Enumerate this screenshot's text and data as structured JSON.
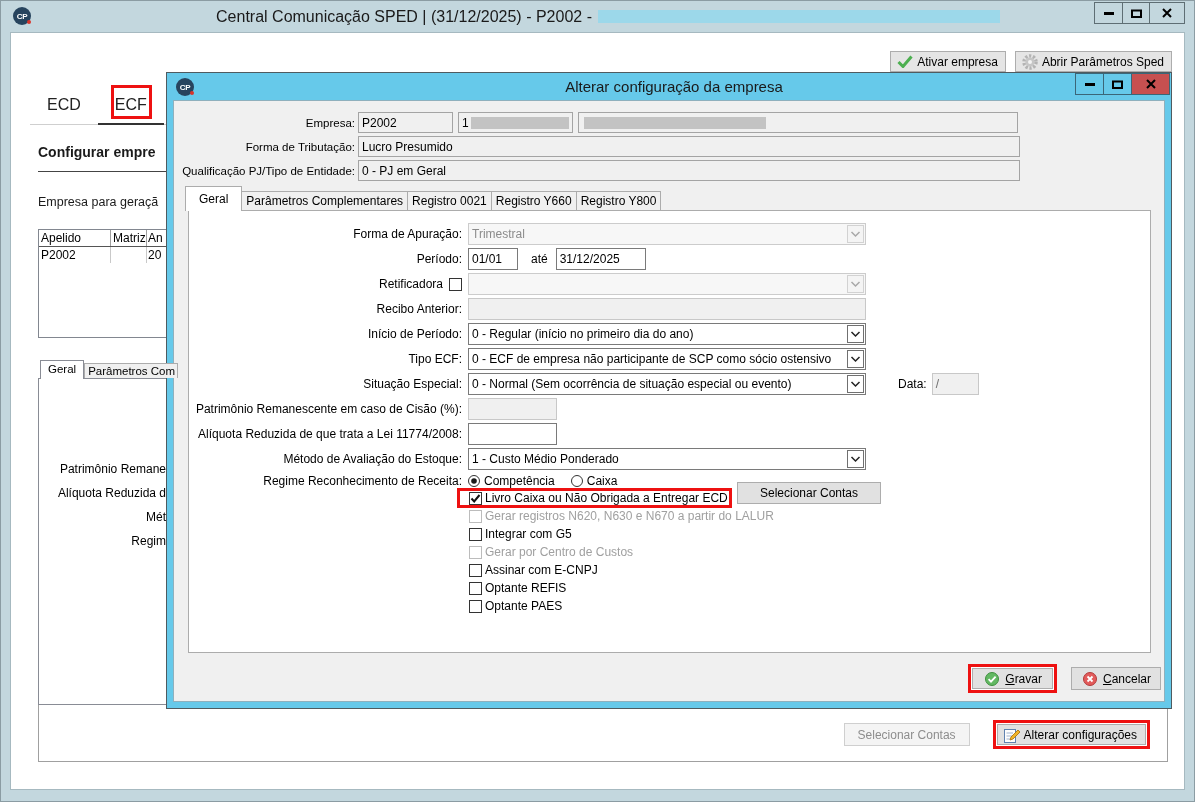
{
  "main_window": {
    "logo_text": "CP",
    "title": "Central Comunicação SPED | (31/12/2025) - P2002 -",
    "title_redacted": true,
    "toolbar_buttons": [
      {
        "label": "Ativar empresa"
      },
      {
        "label": "Abrir Parâmetros Sped"
      }
    ],
    "tabs": [
      {
        "label": "ECD",
        "selected": false,
        "highlighted": false
      },
      {
        "label": "ECF",
        "selected": true,
        "highlighted": true
      }
    ],
    "heading": "Configurar empre",
    "company_prompt": "Empresa para geraçã",
    "table": {
      "columns": [
        "Apelido",
        "Matriz",
        "An"
      ],
      "rows": [
        [
          "P2002",
          null,
          "20"
        ]
      ]
    },
    "panel_tabs": [
      {
        "label": "Geral",
        "selected": true
      },
      {
        "label": "Parâmetros Com",
        "selected": false
      }
    ],
    "panel_labels": [
      "Patrimônio Remane",
      "Alíquota Reduzida d",
      "Mét",
      "Regim"
    ],
    "footer_buttons": [
      {
        "label": "Selecionar Contas",
        "disabled": true,
        "highlighted": false
      },
      {
        "label": "Alterar configurações",
        "disabled": false,
        "highlighted": true
      }
    ]
  },
  "dialog": {
    "logo_text": "CP",
    "title": "Alterar configuração da empresa",
    "header_rows": [
      {
        "label": "Empresa:",
        "fields": [
          {
            "value": "P2002",
            "redacted": false
          },
          {
            "value": "1",
            "redacted": true
          },
          {
            "redacted": true
          }
        ]
      },
      {
        "label": "Forma de Tributação:",
        "fields": [
          {
            "value": "Lucro Presumido",
            "redacted": false
          }
        ]
      },
      {
        "label": "Qualificação PJ/Tipo de Entidade:",
        "fields": [
          {
            "value": "0 - PJ em Geral",
            "redacted": false
          }
        ]
      }
    ],
    "tabs": [
      {
        "label": "Geral",
        "selected": true
      },
      {
        "label": "Parâmetros Complementares",
        "selected": false
      },
      {
        "label": "Registro 0021",
        "selected": false
      },
      {
        "label": "Registro Y660",
        "selected": false
      },
      {
        "label": "Registro Y800",
        "selected": false
      }
    ],
    "form_rows": [
      {
        "kind": "select",
        "label": "Forma de Apuração:",
        "value": "Trimestral",
        "disabled": true
      },
      {
        "kind": "period",
        "label": "Período:",
        "from": "01/01",
        "separator": "até",
        "to": "31/12/2025"
      },
      {
        "kind": "checkselect",
        "label": "Retificadora",
        "checked": false,
        "disabled": true
      },
      {
        "kind": "text",
        "label": "Recibo Anterior:",
        "disabled": true
      },
      {
        "kind": "select",
        "label": "Início de Período:",
        "value": "0 - Regular (início no primeiro dia do ano)",
        "disabled": false
      },
      {
        "kind": "select",
        "label": "Tipo ECF:",
        "value": "0 - ECF de empresa não participante de SCP como sócio ostensivo",
        "disabled": false
      },
      {
        "kind": "selectdate",
        "label": "Situação Especial:",
        "value": "0 - Normal (Sem ocorrência de situação especial ou evento)",
        "disabled": false,
        "date_label": "Data:",
        "date_value": "/",
        "date_disabled": true
      },
      {
        "kind": "number",
        "label": "Patrimônio Remanescente em caso de Cisão (%):",
        "disabled": true
      },
      {
        "kind": "number",
        "label": "Alíquota Reduzida de que trata a Lei 11774/2008:",
        "disabled": false
      },
      {
        "kind": "select",
        "label": "Método de Avaliação do Estoque:",
        "value": "1 - Custo Médio Ponderado",
        "disabled": false
      },
      {
        "kind": "radios",
        "label": "Regime Reconhecimento de Receita:",
        "options": [
          {
            "label": "Competência",
            "selected": true
          },
          {
            "label": "Caixa",
            "selected": false
          }
        ]
      }
    ],
    "options": [
      {
        "label": "Livro Caixa ou Não Obrigada a Entregar ECD",
        "checked": true,
        "disabled": false,
        "highlighted": true
      },
      {
        "label": "Gerar registros N620, N630 e N670 a partir do LALUR",
        "checked": false,
        "disabled": true,
        "highlighted": false
      },
      {
        "label": "Integrar com G5",
        "checked": false,
        "disabled": false,
        "highlighted": false
      },
      {
        "label": "Gerar por Centro de Custos",
        "checked": false,
        "disabled": true,
        "highlighted": false
      },
      {
        "label": "Assinar com E-CNPJ",
        "checked": false,
        "disabled": false,
        "highlighted": false
      },
      {
        "label": "Optante REFIS",
        "checked": false,
        "disabled": false,
        "highlighted": false
      },
      {
        "label": "Optante PAES",
        "checked": false,
        "disabled": false,
        "highlighted": false
      }
    ],
    "select_accounts_button": "Selecionar Contas",
    "buttons": [
      {
        "label": "Gravar",
        "highlighted": true
      },
      {
        "label": "Cancelar",
        "highlighted": false
      }
    ]
  }
}
